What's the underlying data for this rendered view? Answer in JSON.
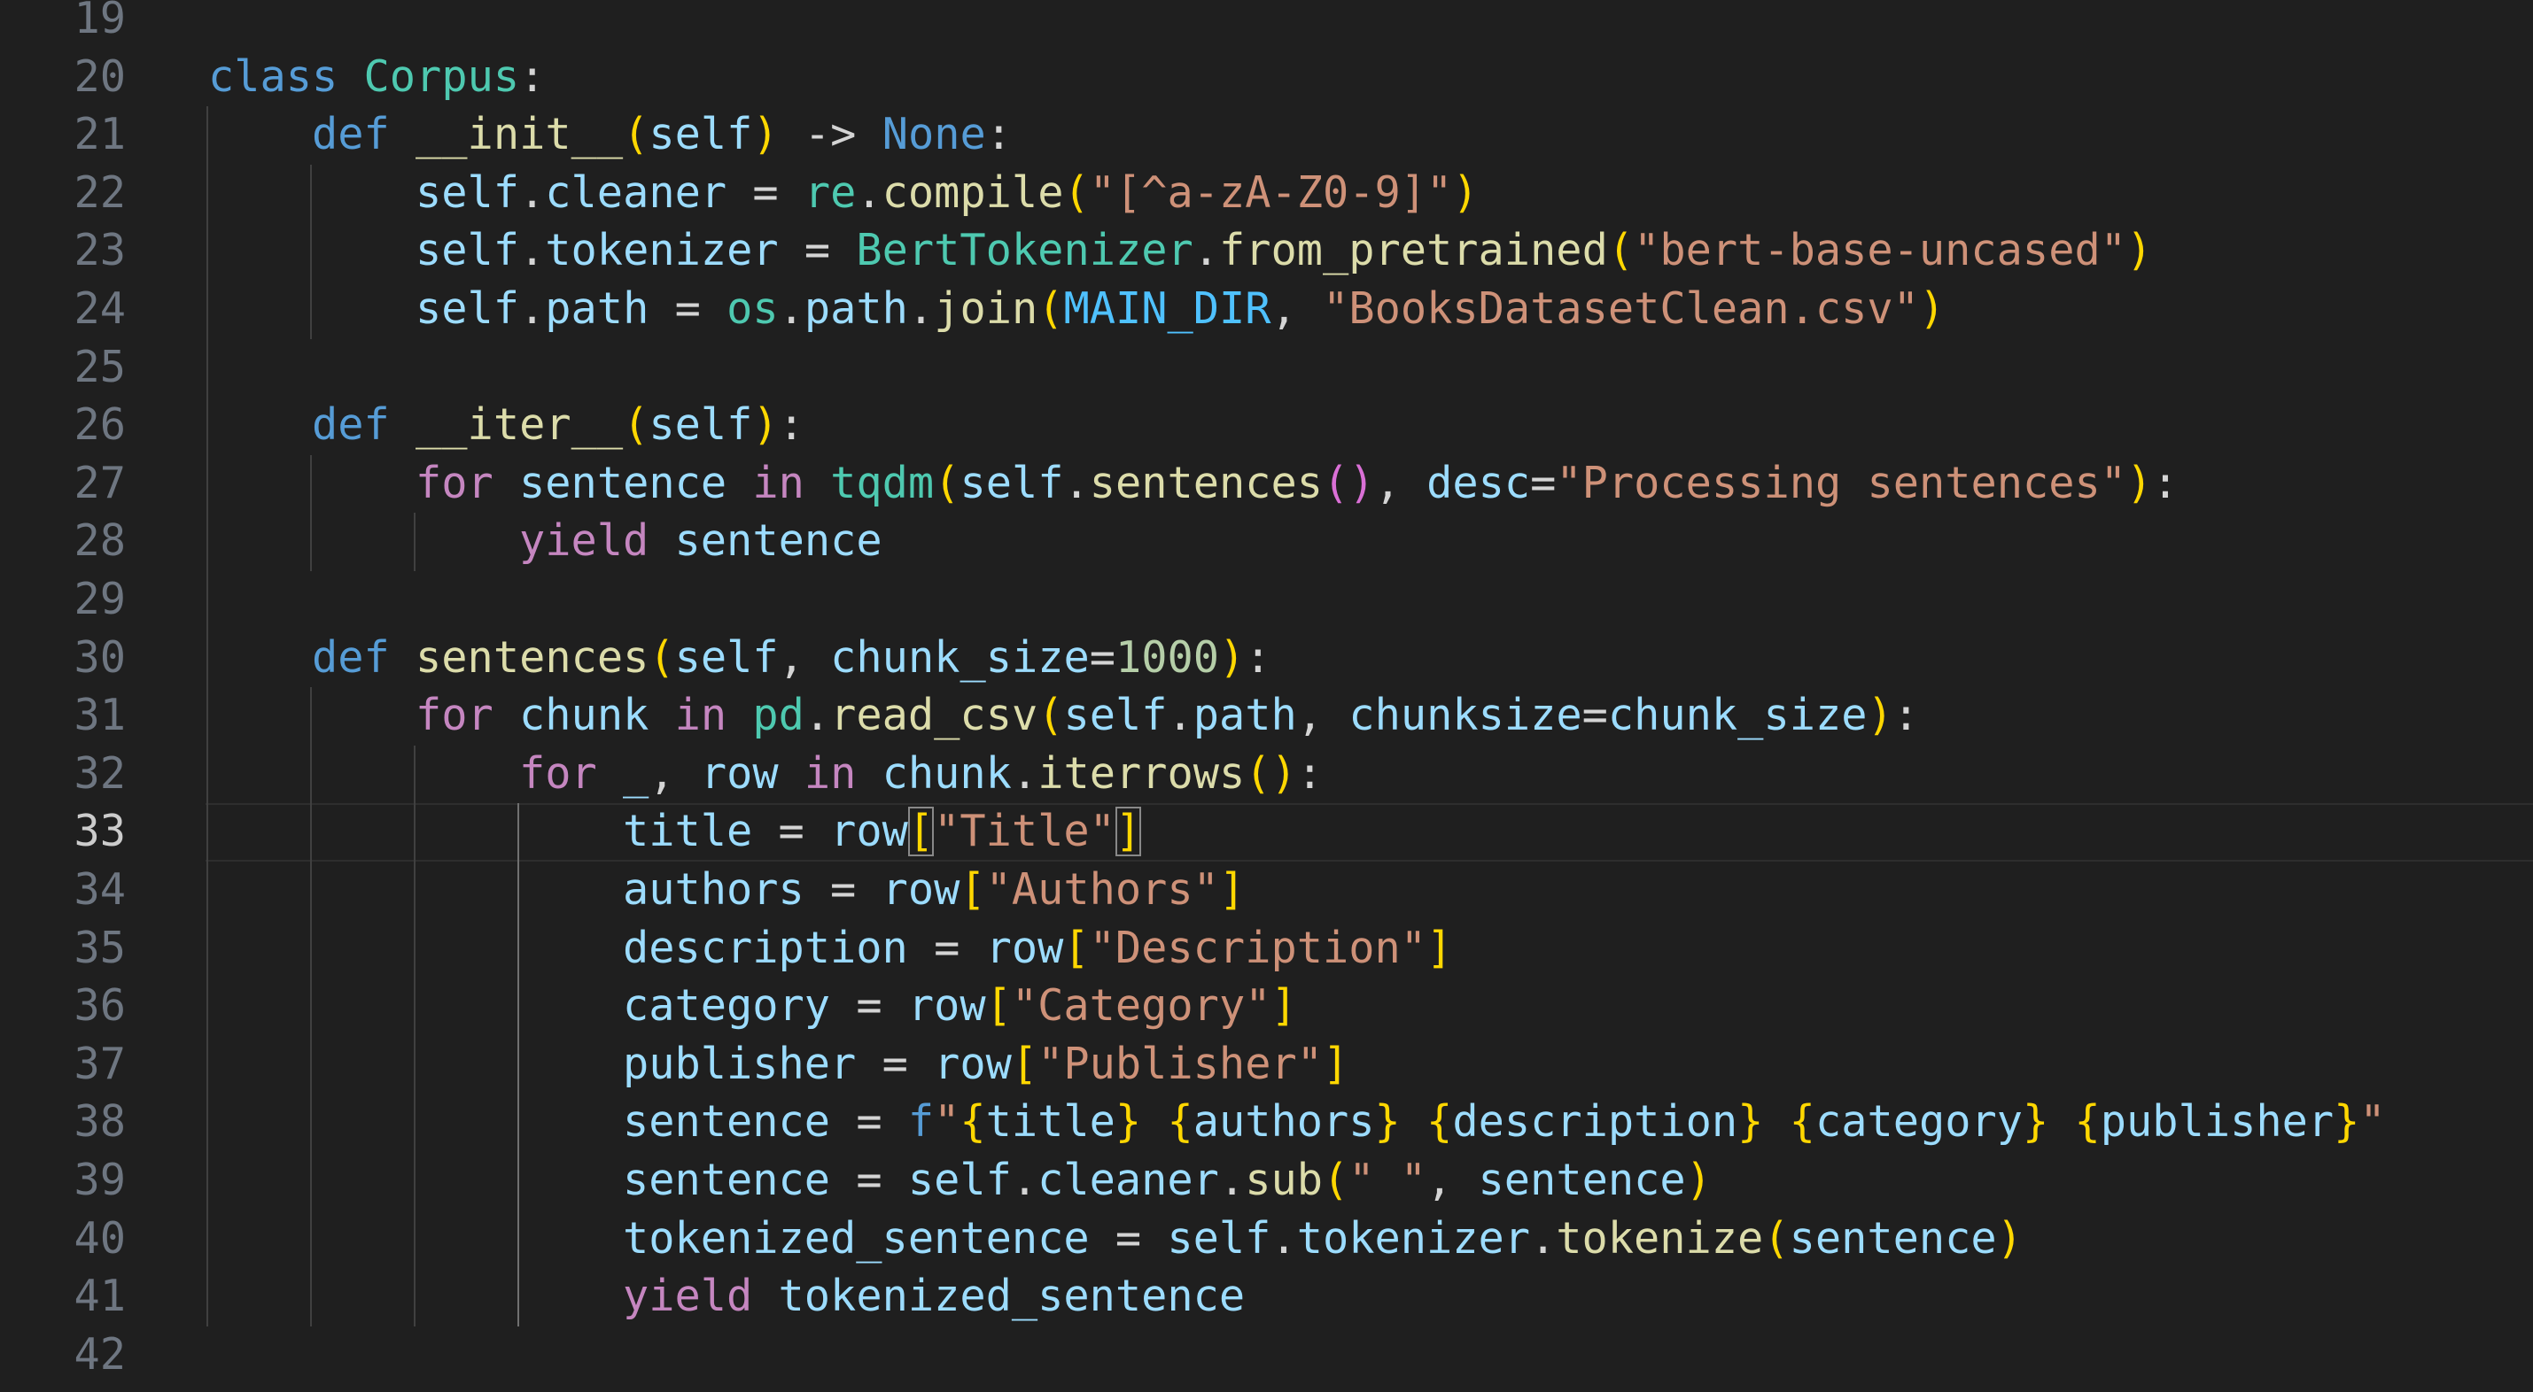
{
  "editor": {
    "active_line": 33,
    "colors": {
      "background": "#1f1f1f",
      "line_number": "#6e7681",
      "line_number_active": "#cccccc",
      "keyword": "#569cd6",
      "control": "#c586c0",
      "class": "#4ec9b0",
      "function": "#dcdcaa",
      "variable": "#9cdcfe",
      "constant": "#4fc1ff",
      "string": "#ce9178",
      "number": "#b5cea8",
      "bracket_level_1": "#ffd700",
      "bracket_level_2": "#da70d6"
    },
    "lines": [
      {
        "num": "19",
        "indent": 0,
        "tokens": []
      },
      {
        "num": "20",
        "indent": 0,
        "tokens": [
          [
            "class",
            "kw"
          ],
          [
            " ",
            "op"
          ],
          [
            "Corpus",
            "cls"
          ],
          [
            ":",
            "op"
          ]
        ]
      },
      {
        "num": "21",
        "indent": 1,
        "tokens": [
          [
            "def",
            "kw"
          ],
          [
            " ",
            "op"
          ],
          [
            "__init__",
            "fn"
          ],
          [
            "(",
            "b1"
          ],
          [
            "self",
            "var"
          ],
          [
            ")",
            "b1"
          ],
          [
            " -> ",
            "op"
          ],
          [
            "None",
            "kw"
          ],
          [
            ":",
            "op"
          ]
        ]
      },
      {
        "num": "22",
        "indent": 2,
        "tokens": [
          [
            "self",
            "var"
          ],
          [
            ".",
            "op"
          ],
          [
            "cleaner",
            "var"
          ],
          [
            " = ",
            "op"
          ],
          [
            "re",
            "cls"
          ],
          [
            ".",
            "op"
          ],
          [
            "compile",
            "fn"
          ],
          [
            "(",
            "b1"
          ],
          [
            "\"[^a-zA-Z0-9]\"",
            "str"
          ],
          [
            ")",
            "b1"
          ]
        ]
      },
      {
        "num": "23",
        "indent": 2,
        "tokens": [
          [
            "self",
            "var"
          ],
          [
            ".",
            "op"
          ],
          [
            "tokenizer",
            "var"
          ],
          [
            " = ",
            "op"
          ],
          [
            "BertTokenizer",
            "cls"
          ],
          [
            ".",
            "op"
          ],
          [
            "from_pretrained",
            "fn"
          ],
          [
            "(",
            "b1"
          ],
          [
            "\"bert-base-uncased\"",
            "str"
          ],
          [
            ")",
            "b1"
          ]
        ]
      },
      {
        "num": "24",
        "indent": 2,
        "tokens": [
          [
            "self",
            "var"
          ],
          [
            ".",
            "op"
          ],
          [
            "path",
            "var"
          ],
          [
            " = ",
            "op"
          ],
          [
            "os",
            "cls"
          ],
          [
            ".",
            "op"
          ],
          [
            "path",
            "var"
          ],
          [
            ".",
            "op"
          ],
          [
            "join",
            "fn"
          ],
          [
            "(",
            "b1"
          ],
          [
            "MAIN_DIR",
            "const"
          ],
          [
            ", ",
            "op"
          ],
          [
            "\"BooksDatasetClean.csv\"",
            "str"
          ],
          [
            ")",
            "b1"
          ]
        ]
      },
      {
        "num": "25",
        "indent": 1,
        "tokens": []
      },
      {
        "num": "26",
        "indent": 1,
        "tokens": [
          [
            "def",
            "kw"
          ],
          [
            " ",
            "op"
          ],
          [
            "__iter__",
            "fn"
          ],
          [
            "(",
            "b1"
          ],
          [
            "self",
            "var"
          ],
          [
            ")",
            "b1"
          ],
          [
            ":",
            "op"
          ]
        ]
      },
      {
        "num": "27",
        "indent": 2,
        "tokens": [
          [
            "for",
            "ctl"
          ],
          [
            " ",
            "op"
          ],
          [
            "sentence",
            "var"
          ],
          [
            " ",
            "op"
          ],
          [
            "in",
            "ctl"
          ],
          [
            " ",
            "op"
          ],
          [
            "tqdm",
            "cls"
          ],
          [
            "(",
            "b1"
          ],
          [
            "self",
            "var"
          ],
          [
            ".",
            "op"
          ],
          [
            "sentences",
            "fn"
          ],
          [
            "(",
            "b2"
          ],
          [
            ")",
            "b2"
          ],
          [
            ", ",
            "op"
          ],
          [
            "desc",
            "var"
          ],
          [
            "=",
            "op"
          ],
          [
            "\"Processing sentences\"",
            "str"
          ],
          [
            ")",
            "b1"
          ],
          [
            ":",
            "op"
          ]
        ]
      },
      {
        "num": "28",
        "indent": 3,
        "tokens": [
          [
            "yield",
            "ctl"
          ],
          [
            " ",
            "op"
          ],
          [
            "sentence",
            "var"
          ]
        ]
      },
      {
        "num": "29",
        "indent": 1,
        "tokens": []
      },
      {
        "num": "30",
        "indent": 1,
        "tokens": [
          [
            "def",
            "kw"
          ],
          [
            " ",
            "op"
          ],
          [
            "sentences",
            "fn"
          ],
          [
            "(",
            "b1"
          ],
          [
            "self",
            "var"
          ],
          [
            ", ",
            "op"
          ],
          [
            "chunk_size",
            "var"
          ],
          [
            "=",
            "op"
          ],
          [
            "1000",
            "num"
          ],
          [
            ")",
            "b1"
          ],
          [
            ":",
            "op"
          ]
        ]
      },
      {
        "num": "31",
        "indent": 2,
        "tokens": [
          [
            "for",
            "ctl"
          ],
          [
            " ",
            "op"
          ],
          [
            "chunk",
            "var"
          ],
          [
            " ",
            "op"
          ],
          [
            "in",
            "ctl"
          ],
          [
            " ",
            "op"
          ],
          [
            "pd",
            "cls"
          ],
          [
            ".",
            "op"
          ],
          [
            "read_csv",
            "fn"
          ],
          [
            "(",
            "b1"
          ],
          [
            "self",
            "var"
          ],
          [
            ".",
            "op"
          ],
          [
            "path",
            "var"
          ],
          [
            ", ",
            "op"
          ],
          [
            "chunksize",
            "var"
          ],
          [
            "=",
            "op"
          ],
          [
            "chunk_size",
            "var"
          ],
          [
            ")",
            "b1"
          ],
          [
            ":",
            "op"
          ]
        ]
      },
      {
        "num": "32",
        "indent": 3,
        "tokens": [
          [
            "for",
            "ctl"
          ],
          [
            " ",
            "op"
          ],
          [
            "_",
            "var"
          ],
          [
            ", ",
            "op"
          ],
          [
            "row",
            "var"
          ],
          [
            " ",
            "op"
          ],
          [
            "in",
            "ctl"
          ],
          [
            " ",
            "op"
          ],
          [
            "chunk",
            "var"
          ],
          [
            ".",
            "op"
          ],
          [
            "iterrows",
            "fn"
          ],
          [
            "(",
            "b1"
          ],
          [
            ")",
            "b1"
          ],
          [
            ":",
            "op"
          ]
        ]
      },
      {
        "num": "33",
        "indent": 4,
        "tokens": [
          [
            "title",
            "var"
          ],
          [
            " = ",
            "op"
          ],
          [
            "row",
            "var"
          ],
          [
            "[",
            "b1 bracket-match"
          ],
          [
            "\"Title\"",
            "str"
          ],
          [
            "]",
            "b1 bracket-match"
          ]
        ]
      },
      {
        "num": "34",
        "indent": 4,
        "tokens": [
          [
            "authors",
            "var"
          ],
          [
            " = ",
            "op"
          ],
          [
            "row",
            "var"
          ],
          [
            "[",
            "b1"
          ],
          [
            "\"Authors\"",
            "str"
          ],
          [
            "]",
            "b1"
          ]
        ]
      },
      {
        "num": "35",
        "indent": 4,
        "tokens": [
          [
            "description",
            "var"
          ],
          [
            " = ",
            "op"
          ],
          [
            "row",
            "var"
          ],
          [
            "[",
            "b1"
          ],
          [
            "\"Description\"",
            "str"
          ],
          [
            "]",
            "b1"
          ]
        ]
      },
      {
        "num": "36",
        "indent": 4,
        "tokens": [
          [
            "category",
            "var"
          ],
          [
            " = ",
            "op"
          ],
          [
            "row",
            "var"
          ],
          [
            "[",
            "b1"
          ],
          [
            "\"Category\"",
            "str"
          ],
          [
            "]",
            "b1"
          ]
        ]
      },
      {
        "num": "37",
        "indent": 4,
        "tokens": [
          [
            "publisher",
            "var"
          ],
          [
            " = ",
            "op"
          ],
          [
            "row",
            "var"
          ],
          [
            "[",
            "b1"
          ],
          [
            "\"Publisher\"",
            "str"
          ],
          [
            "]",
            "b1"
          ]
        ]
      },
      {
        "num": "38",
        "indent": 4,
        "tokens": [
          [
            "sentence",
            "var"
          ],
          [
            " = ",
            "op"
          ],
          [
            "f",
            "kw"
          ],
          [
            "\"",
            "str"
          ],
          [
            "{",
            "b1"
          ],
          [
            "title",
            "var"
          ],
          [
            "}",
            "b1"
          ],
          [
            " ",
            "str"
          ],
          [
            "{",
            "b1"
          ],
          [
            "authors",
            "var"
          ],
          [
            "}",
            "b1"
          ],
          [
            " ",
            "str"
          ],
          [
            "{",
            "b1"
          ],
          [
            "description",
            "var"
          ],
          [
            "}",
            "b1"
          ],
          [
            " ",
            "str"
          ],
          [
            "{",
            "b1"
          ],
          [
            "category",
            "var"
          ],
          [
            "}",
            "b1"
          ],
          [
            " ",
            "str"
          ],
          [
            "{",
            "b1"
          ],
          [
            "publisher",
            "var"
          ],
          [
            "}",
            "b1"
          ],
          [
            "\"",
            "str"
          ]
        ]
      },
      {
        "num": "39",
        "indent": 4,
        "tokens": [
          [
            "sentence",
            "var"
          ],
          [
            " = ",
            "op"
          ],
          [
            "self",
            "var"
          ],
          [
            ".",
            "op"
          ],
          [
            "cleaner",
            "var"
          ],
          [
            ".",
            "op"
          ],
          [
            "sub",
            "fn"
          ],
          [
            "(",
            "b1"
          ],
          [
            "\" \"",
            "str"
          ],
          [
            ", ",
            "op"
          ],
          [
            "sentence",
            "var"
          ],
          [
            ")",
            "b1"
          ]
        ]
      },
      {
        "num": "40",
        "indent": 4,
        "tokens": [
          [
            "tokenized_sentence",
            "var"
          ],
          [
            " = ",
            "op"
          ],
          [
            "self",
            "var"
          ],
          [
            ".",
            "op"
          ],
          [
            "tokenizer",
            "var"
          ],
          [
            ".",
            "op"
          ],
          [
            "tokenize",
            "fn"
          ],
          [
            "(",
            "b1"
          ],
          [
            "sentence",
            "var"
          ],
          [
            ")",
            "b1"
          ]
        ]
      },
      {
        "num": "41",
        "indent": 4,
        "tokens": [
          [
            "yield",
            "ctl"
          ],
          [
            " ",
            "op"
          ],
          [
            "tokenized_sentence",
            "var"
          ]
        ]
      },
      {
        "num": "42",
        "indent": 0,
        "tokens": []
      }
    ]
  }
}
